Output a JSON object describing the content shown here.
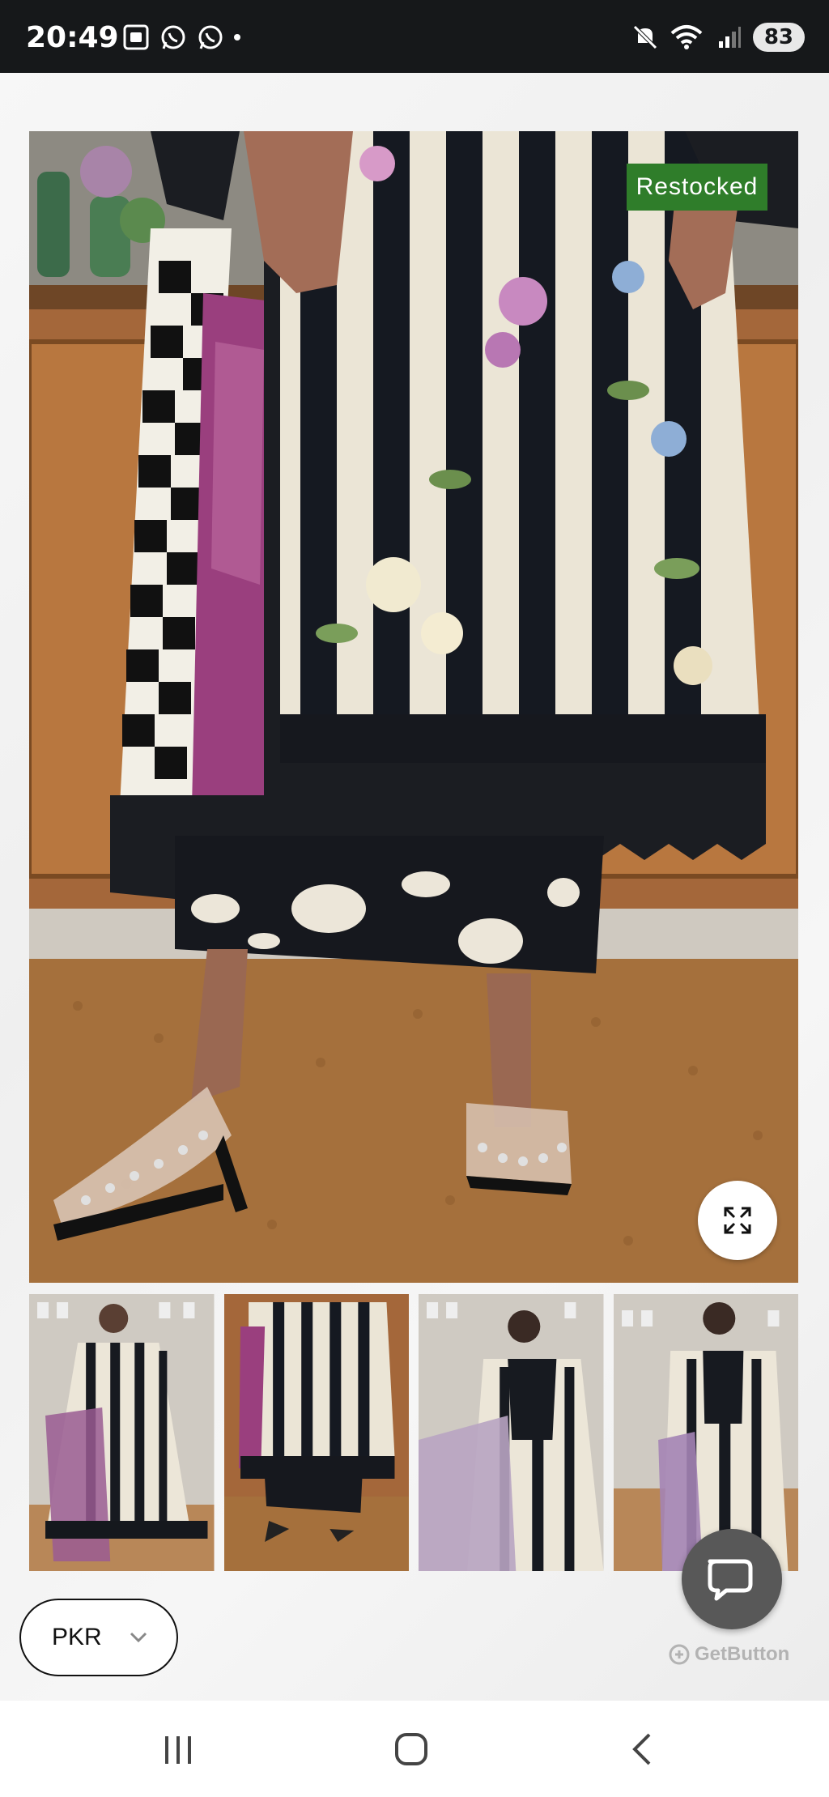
{
  "status_bar": {
    "time": "20:49",
    "battery": "83",
    "icons": [
      "screenshot-icon",
      "whatsapp-icon",
      "whatsapp-business-icon",
      "dot-icon",
      "mute-icon",
      "wifi-icon",
      "signal-icon"
    ]
  },
  "product": {
    "badge": "Restocked",
    "badge_color": "#2f7d2a",
    "thumbnails_count": 4
  },
  "currency": {
    "label": "PKR"
  },
  "chat": {
    "brand": "GetButton",
    "button_color": "#585858"
  },
  "nav": {
    "buttons": [
      "recent-apps-icon",
      "home-icon",
      "back-icon"
    ]
  }
}
